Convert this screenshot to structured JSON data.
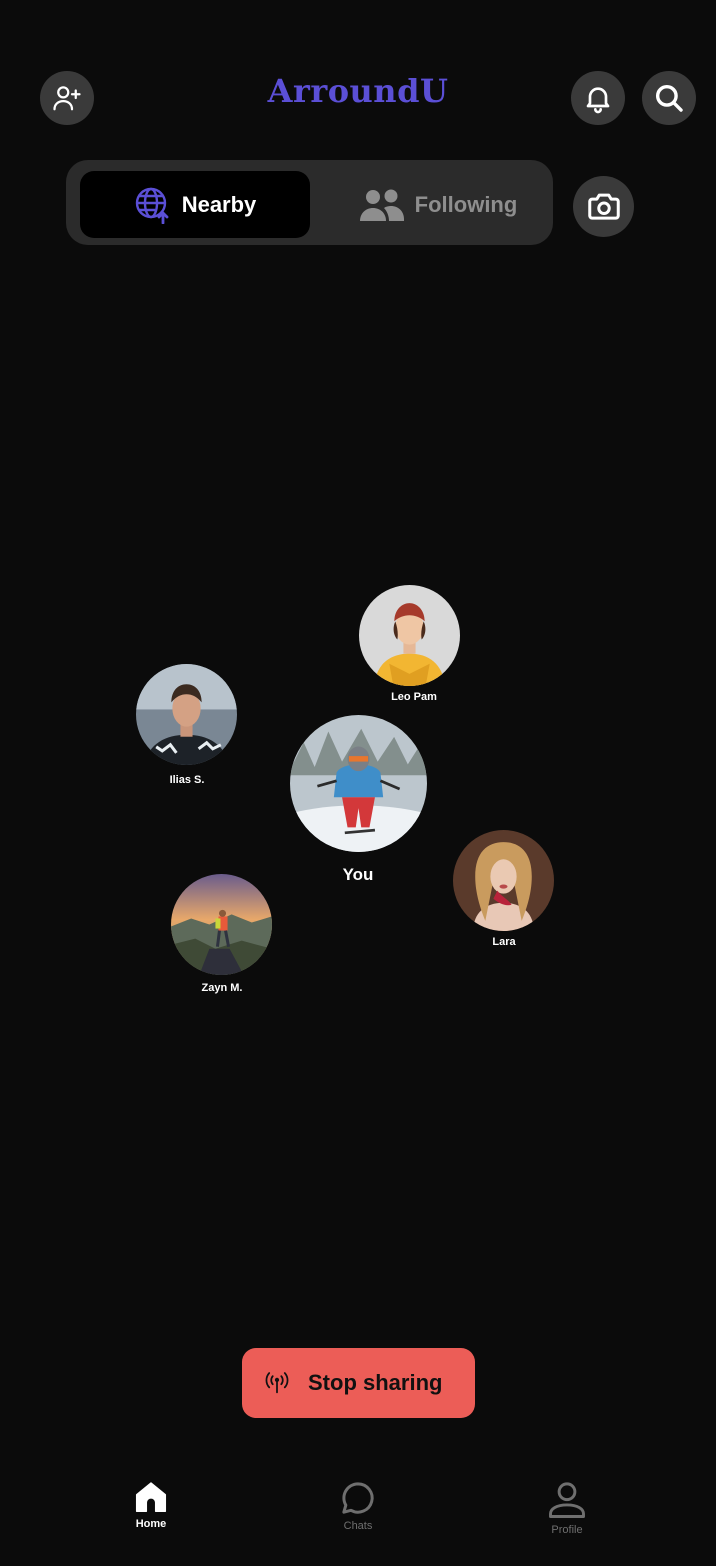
{
  "header": {
    "title": "ArroundU",
    "title_color": "#5b4fd6",
    "left_icon": "add-user-icon",
    "right_icons": [
      "bell-icon",
      "search-icon"
    ]
  },
  "tabs": {
    "items": [
      {
        "label": "Nearby",
        "icon": "globe-location-icon",
        "active": true
      },
      {
        "label": "Following",
        "icon": "users-icon",
        "active": false
      }
    ],
    "camera_icon": "camera-icon"
  },
  "nearby": {
    "people": [
      {
        "name": "Leo Pam"
      },
      {
        "name": "Ilias S."
      },
      {
        "name": "You"
      },
      {
        "name": "Lara"
      },
      {
        "name": "Zayn M."
      }
    ]
  },
  "stop_sharing": {
    "label": "Stop sharing",
    "icon": "broadcast-icon",
    "color": "#ec5d57"
  },
  "bottom_nav": {
    "items": [
      {
        "label": "Home",
        "icon": "home-icon",
        "active": true
      },
      {
        "label": "Chats",
        "icon": "chat-bubble-icon",
        "active": false
      },
      {
        "label": "Profile",
        "icon": "profile-icon",
        "active": false
      }
    ]
  }
}
